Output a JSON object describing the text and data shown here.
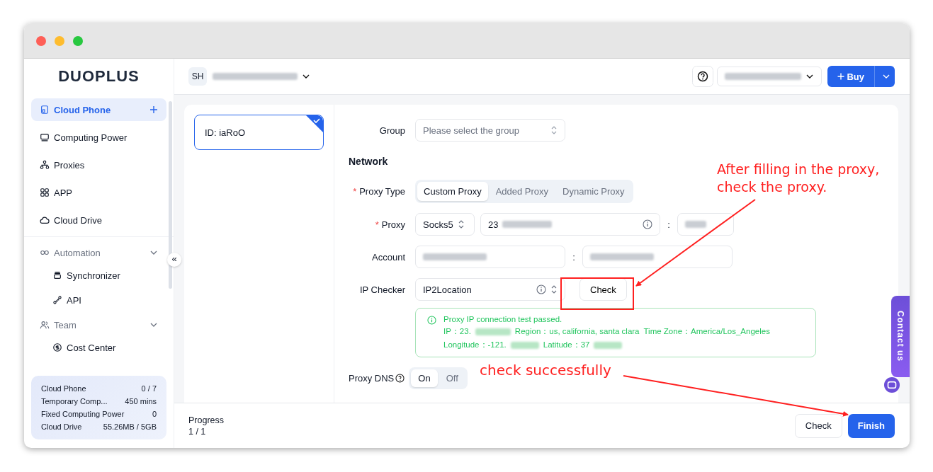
{
  "logo": "DUOPLUS",
  "sidebar": {
    "items": [
      {
        "kind": "item",
        "label": "Cloud Phone",
        "selected": true,
        "addable": true
      },
      {
        "kind": "item",
        "label": "Computing Power",
        "selected": false
      },
      {
        "kind": "item",
        "label": "Proxies",
        "selected": false
      },
      {
        "kind": "item",
        "label": "APP",
        "selected": false
      },
      {
        "kind": "item",
        "label": "Cloud Drive",
        "selected": false
      },
      {
        "kind": "group",
        "label": "Automation",
        "expanded": true,
        "children": [
          {
            "kind": "item",
            "label": "Synchronizer",
            "selected": false
          },
          {
            "kind": "item",
            "label": "API",
            "selected": false
          }
        ]
      },
      {
        "kind": "group",
        "label": "Team",
        "expanded": true,
        "children": [
          {
            "kind": "item",
            "label": "Cost Center",
            "selected": false
          }
        ]
      }
    ],
    "collapse_button": "«",
    "usage": [
      {
        "label": "Cloud Phone",
        "value": "0 / 7"
      },
      {
        "label": "Temporary Comp...",
        "value": "450 mins"
      },
      {
        "label": "Fixed Computing Power",
        "value": "0"
      },
      {
        "label": "Cloud Drive",
        "value": "55.26MB / 5GB"
      }
    ]
  },
  "header": {
    "workspace_badge": "SH",
    "buy_button": "Buy"
  },
  "devices": [
    {
      "id": "ID: iaRoO",
      "selected": true
    }
  ],
  "form": {
    "group": {
      "label": "Group",
      "placeholder": "Please select the group"
    },
    "section_title": "Network",
    "required_mark": "*",
    "proxy_type": {
      "label": "Proxy Type",
      "required": true,
      "tabs": [
        {
          "label": "Custom Proxy",
          "selected": true
        },
        {
          "label": "Added Proxy",
          "selected": false
        },
        {
          "label": "Dynamic Proxy",
          "selected": false
        }
      ]
    },
    "proxy": {
      "label": "Proxy",
      "required": true,
      "protocol": "Socks5",
      "host": "23",
      "separator": ":"
    },
    "account": {
      "label": "Account",
      "separator": ":"
    },
    "ip_checker": {
      "label": "IP Checker",
      "value": "IP2Location",
      "check_button": "Check"
    },
    "result": {
      "title": "Proxy IP connection test passed.",
      "ip": "IP：23.",
      "region": "Region：us, california, santa clara",
      "time_zone": "Time Zone：America/Los_Angeles",
      "longitude": "Longitude：-121.",
      "latitude": "Latitude：37"
    },
    "proxy_dns": {
      "label": "Proxy DNS",
      "options": [
        {
          "label": "On",
          "selected": true
        },
        {
          "label": "Off",
          "selected": false
        }
      ]
    }
  },
  "footer": {
    "progress_label": "Progress",
    "progress_value": "1 / 1",
    "buttons": [
      {
        "label": "Check",
        "kind": "secondary"
      },
      {
        "label": "Finish",
        "kind": "primary"
      }
    ]
  },
  "annotations": [
    {
      "text": "After filling in the proxy,\ncheck the proxy."
    },
    {
      "text": "check successfully"
    }
  ],
  "contact_tab": "Contact us"
}
